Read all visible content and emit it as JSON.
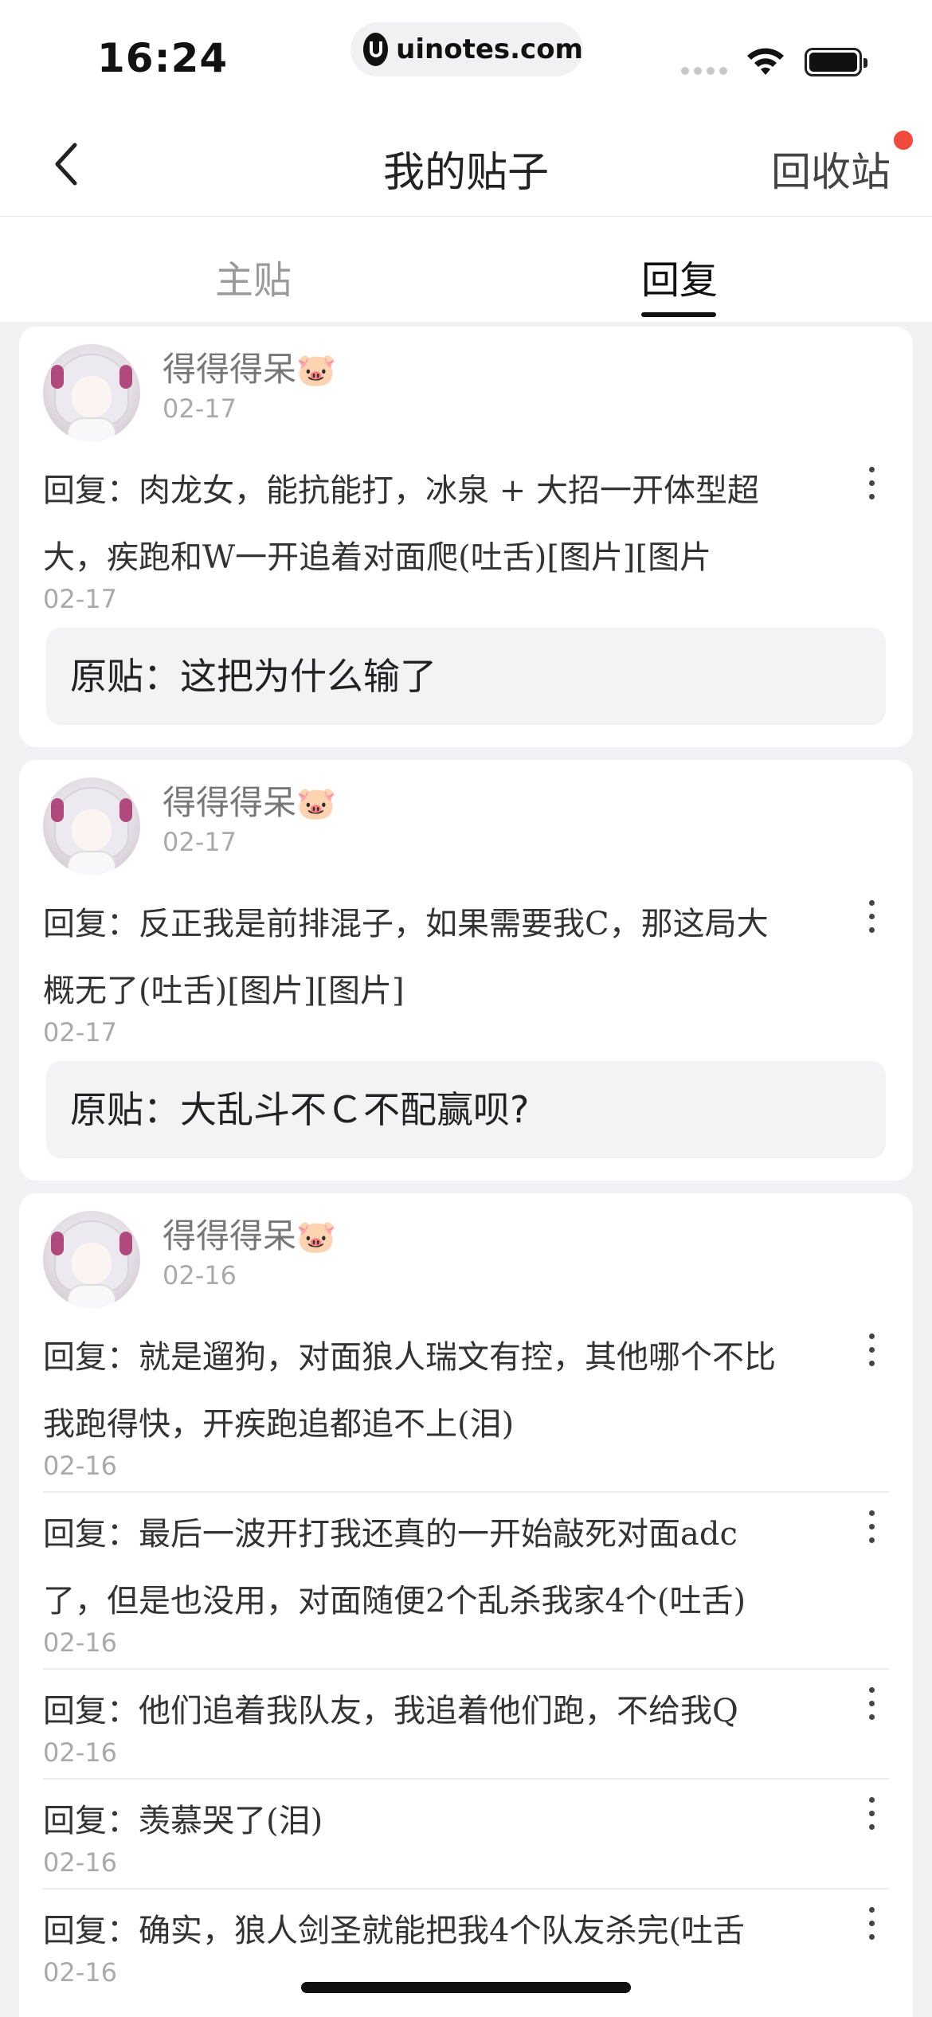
{
  "status_bar": {
    "time": "16:24",
    "url": "uinotes.com"
  },
  "nav": {
    "title": "我的贴子",
    "recycle_label": "回收站"
  },
  "tabs": [
    {
      "label": "主贴",
      "active": false
    },
    {
      "label": "回复",
      "active": true
    }
  ],
  "cards": [
    {
      "user": "得得得呆",
      "user_emoji": "🐷",
      "date": "02-17",
      "replies": [
        {
          "text": "回复：肉龙女，能抗能打，冰泉 + 大招一开体型超大，疾跑和W一开追着对面爬(吐舌)[图片][图片",
          "date": "02-17"
        }
      ],
      "original": "原贴：这把为什么输了"
    },
    {
      "user": "得得得呆",
      "user_emoji": "🐷",
      "date": "02-17",
      "replies": [
        {
          "text": "回复：反正我是前排混子，如果需要我C，那这局大概无了(吐舌)[图片][图片]",
          "date": "02-17"
        }
      ],
      "original": "原贴：大乱斗不Ｃ不配赢呗?"
    },
    {
      "user": "得得得呆",
      "user_emoji": "🐷",
      "date": "02-16",
      "replies": [
        {
          "text": "回复：就是遛狗，对面狼人瑞文有控，其他哪个不比我跑得快，开疾跑追都追不上(泪)",
          "date": "02-16"
        },
        {
          "text": "回复：最后一波开打我还真的一开始敲死对面adc了，但是也没用，对面随便2个乱杀我家4个(吐舌)",
          "date": "02-16"
        },
        {
          "text": "回复：他们追着我队友，我追着他们跑，不给我Q",
          "date": "02-16"
        },
        {
          "text": "回复：羡慕哭了(泪)",
          "date": "02-16"
        },
        {
          "text": "回复：确实，狼人剑圣就能把我4个队友杀完(吐舌",
          "date": "02-16"
        }
      ]
    }
  ],
  "colors": {
    "background": "#f2f2f4",
    "card": "#ffffff",
    "notification_dot": "#f04a3c",
    "muted_text": "#aaaaaa"
  }
}
